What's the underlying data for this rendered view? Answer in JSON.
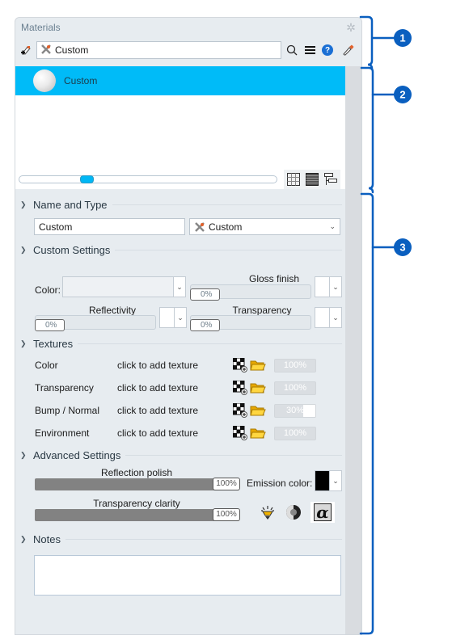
{
  "panel": {
    "title": "Materials",
    "settings_icon": "gear-icon"
  },
  "toolbar": {
    "new_material_icon": "add-material-icon",
    "search_value": "Custom",
    "search_type_icon": "custom-material-icon",
    "search_icon": "search-icon",
    "menu_icon": "menu-icon",
    "help_icon": "help-icon",
    "help_glyph": "?",
    "eyedropper_icon": "eyedropper-icon"
  },
  "material_list": {
    "items": [
      {
        "name": "Custom",
        "selected": true,
        "thumbnail": "white-sphere"
      }
    ],
    "zoom_slider_value": 0.25,
    "view_buttons": [
      "grid-view-icon",
      "list-view-icon",
      "tree-view-icon"
    ]
  },
  "name_and_type": {
    "header": "Name and Type",
    "name_value": "Custom",
    "type_value": "Custom"
  },
  "custom_settings": {
    "header": "Custom Settings",
    "color_label": "Color:",
    "gloss_label": "Gloss finish",
    "gloss_value": "0%",
    "reflectivity_label": "Reflectivity",
    "reflectivity_value": "0%",
    "transparency_label": "Transparency",
    "transparency_value": "0%"
  },
  "textures": {
    "header": "Textures",
    "rows": [
      {
        "label": "Color",
        "action": "click to add texture",
        "value": "100%",
        "fill": 0
      },
      {
        "label": "Transparency",
        "action": "click to add texture",
        "value": "100%",
        "fill": 0
      },
      {
        "label": "Bump / Normal",
        "action": "click to add texture",
        "value": "30%",
        "fill": 0.7
      },
      {
        "label": "Environment",
        "action": "click to add texture",
        "value": "100%",
        "fill": 0
      }
    ]
  },
  "advanced": {
    "header": "Advanced Settings",
    "reflection_polish_label": "Reflection polish",
    "reflection_polish_value": "100%",
    "emission_label": "Emission color:",
    "emission_color": "#000000",
    "transparency_clarity_label": "Transparency clarity",
    "transparency_clarity_value": "100%",
    "icons": [
      "light-emission-icon",
      "contrast-icon",
      "alpha-icon"
    ],
    "alpha_glyph": "α"
  },
  "notes": {
    "header": "Notes",
    "value": ""
  },
  "callouts": [
    "1",
    "2",
    "3"
  ],
  "colors": {
    "accent": "#00bbf8",
    "callout": "#0a5fbf"
  }
}
